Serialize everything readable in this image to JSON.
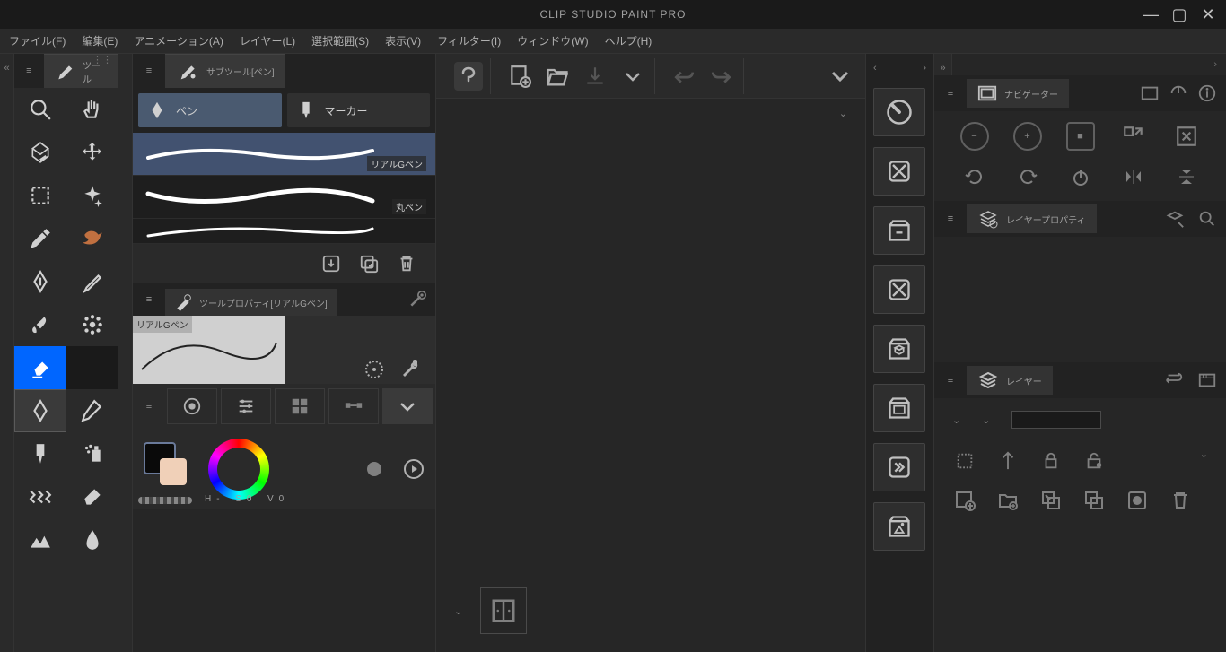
{
  "app_title": "CLIP STUDIO PAINT PRO",
  "menubar": [
    "ファイル(F)",
    "編集(E)",
    "アニメーション(A)",
    "レイヤー(L)",
    "選択範囲(S)",
    "表示(V)",
    "フィルター(I)",
    "ウィンドウ(W)",
    "ヘルプ(H)"
  ],
  "tool_panel_label": "ツール",
  "subtool_panel_label": "サブツール[ペン]",
  "subtool_tabs": {
    "pen": "ペン",
    "marker": "マーカー"
  },
  "brushes": [
    {
      "name": "リアルGペン"
    },
    {
      "name": "丸ペン"
    },
    {
      "name": ""
    }
  ],
  "tool_property_label": "ツールプロパティ[リアルGペン]",
  "brush_preview_name": "リアルGペン",
  "nav_tab": "ナビゲーター",
  "layer_prop_tab": "レイヤープロパティ",
  "layer_tab": "レイヤー",
  "hsv": {
    "h": "H",
    "hv": "-",
    "s": "S",
    "sv": "0",
    "v": "V",
    "vv": "0"
  }
}
